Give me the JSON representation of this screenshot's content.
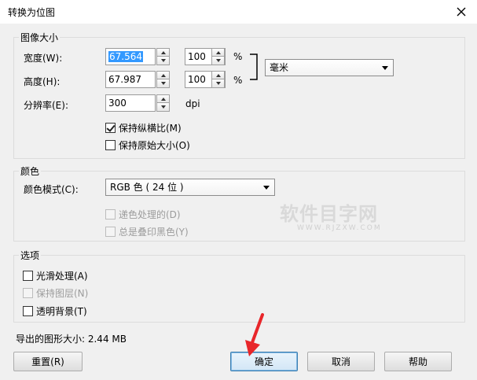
{
  "window": {
    "title": "转换为位图"
  },
  "image_size": {
    "group_title": "图像大小",
    "width_label": "宽度(W):",
    "width_value": "67.564",
    "width_percent": "100",
    "height_label": "高度(H):",
    "height_value": "67.987",
    "height_percent": "100",
    "percent_unit": "%",
    "unit_select": "毫米",
    "resolution_label": "分辨率(E):",
    "resolution_value": "300",
    "resolution_unit": "dpi",
    "keep_ratio": "保持纵横比(M)",
    "keep_original": "保持原始大小(O)"
  },
  "color": {
    "group_title": "颜色",
    "mode_label": "颜色模式(C):",
    "mode_value": "RGB 色 ( 24 位 )",
    "dithering": "递色处理的(D)",
    "overprint_black": "总是叠印黑色(Y)"
  },
  "options": {
    "group_title": "选项",
    "anti_alias": "光滑处理(A)",
    "keep_layers": "保持图层(N)",
    "transparent_bg": "透明背景(T)"
  },
  "export_size": "导出的图形大小: 2.44 MB",
  "buttons": {
    "reset": "重置(R)",
    "ok": "确定",
    "cancel": "取消",
    "help": "帮助"
  },
  "watermark": {
    "main": "软件目字网",
    "sub": "WWW.RJZXW.COM"
  },
  "colors": {
    "selection": "#3399ff",
    "annotation_arrow": "#e8262a",
    "watermark": "#d9d9d9"
  }
}
